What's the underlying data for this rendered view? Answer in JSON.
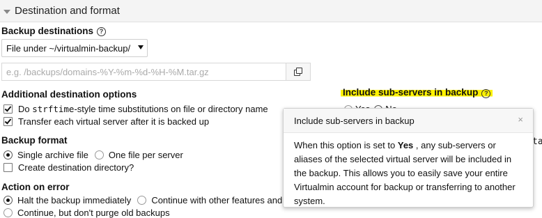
{
  "section": {
    "title": "Destination and format"
  },
  "backup_destinations": {
    "label": "Backup destinations",
    "help_icon": "question-circle-icon",
    "select_value": "File under ~/virtualmin-backup/",
    "path_placeholder": "e.g. /backups/domains-%Y-%m-%d-%H-%M.tar.gz",
    "copy_icon": "copy-icon"
  },
  "additional_options": {
    "label": "Additional destination options",
    "strftime_prefix": "Do ",
    "strftime_code": "strftime",
    "strftime_suffix": "-style time substitutions on file or directory name",
    "strftime_checked": true,
    "transfer_label": "Transfer each virtual server after it is backed up",
    "transfer_checked": true
  },
  "backup_format": {
    "label": "Backup format",
    "options": [
      "Single archive file",
      "One file per server"
    ],
    "selected": "Single archive file",
    "create_dir_label": "Create destination directory?",
    "create_dir_checked": false
  },
  "action_on_error": {
    "label": "Action on error",
    "options": [
      "Halt the backup immediately",
      "Continue with other features and s",
      "Continue, but don't purge old backups"
    ],
    "selected": "Halt the backup immediately"
  },
  "include_subservers": {
    "label": "Include sub-servers in backup",
    "help_icon": "question-circle-icon",
    "highlight_color": "#fff200",
    "yes_label": "Yes",
    "no_label": "No",
    "selected": "No",
    "peek_text": "ta"
  },
  "popover": {
    "title": "Include sub-servers in backup",
    "close_glyph": "×",
    "body_before": "When this option is set to ",
    "body_bold": "Yes",
    "body_after": " , any sub-servers or aliases of the selected virtual server will be included in the backup. This allows you to easily save your entire Virtualmin account for backup or transferring to another system."
  }
}
